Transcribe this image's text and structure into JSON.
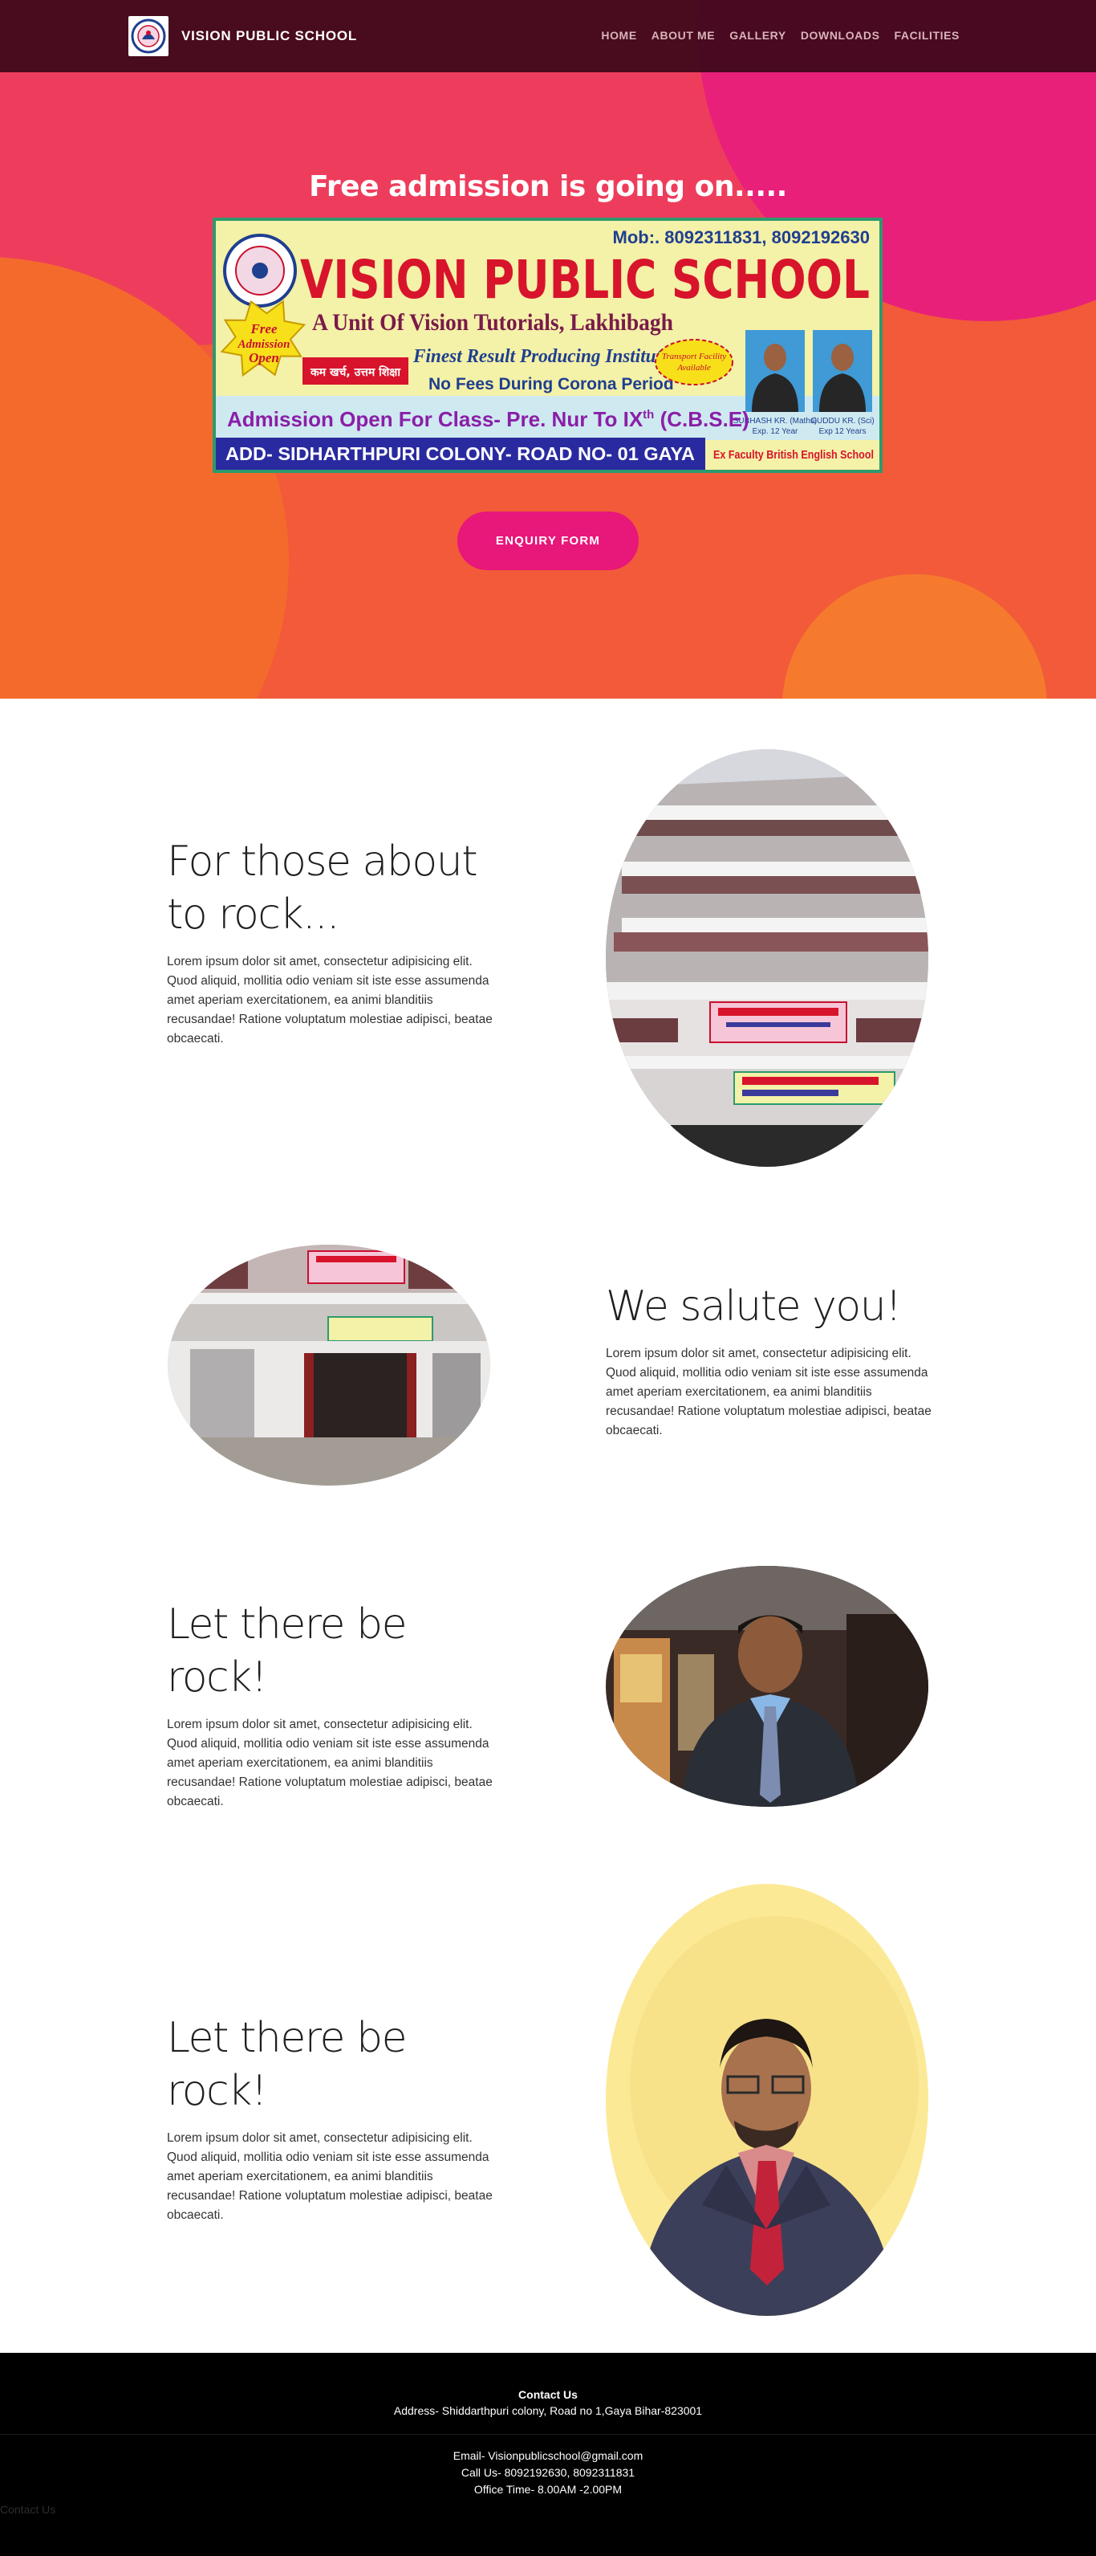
{
  "brand": {
    "name": "VISION PUBLIC SCHOOL",
    "logo_icon": "school-crest-icon"
  },
  "nav": {
    "items": [
      "HOME",
      "ABOUT ME",
      "GALLERY",
      "DOWNLOADS",
      "FACILITIES"
    ]
  },
  "hero": {
    "title": "Free admission is going on.....",
    "button_label": "ENQUIRY FORM",
    "banner": {
      "mob": "Mob:. 8092311831, 8092192630",
      "school_name": "VISION PUBLIC SCHOOL",
      "unit_line": "A Unit Of Vision Tutorials, Lakhibagh",
      "badge_free": "Free",
      "badge_admission": "Admission",
      "badge_open": "Open",
      "hindi_tag": "कम खर्च, उत्तम शिक्षा",
      "result_line": "Finest Result Producing Institution",
      "no_fees": "No Fees During Corona Period",
      "transport_1": "Transport Facility",
      "transport_2": "Available",
      "admission_line": "Admission Open For Class- Pre. Nur To IX",
      "admission_sup": "th",
      "admission_board": " (C.B.S.E)",
      "address_line": "ADD- SIDHARTHPURI COLONY- ROAD NO- 01 GAYA",
      "ex_faculty": "Ex Faculty British English School",
      "teacher1_name": "SUBHASH KR. (Maths)",
      "teacher1_exp": "Exp. 12 Year",
      "teacher2_name": "GUDDU KR. (Sci)",
      "teacher2_exp": "Exp 12 Years"
    }
  },
  "sections": [
    {
      "heading_line1": "For those about",
      "heading_line2": "to rock...",
      "body": "Lorem ipsum dolor sit amet, consectetur adipisicing elit. Quod aliquid, mollitia odio veniam sit iste esse assumenda amet aperiam exercitationem, ea animi blanditiis recusandae! Ratione voluptatum molestiae adipisci, beatae obcaecati.",
      "image": "school-building-photo"
    },
    {
      "heading": "We salute you!",
      "body": "Lorem ipsum dolor sit amet, consectetur adipisicing elit. Quod aliquid, mollitia odio veniam sit iste esse assumenda amet aperiam exercitationem, ea animi blanditiis recusandae! Ratione voluptatum molestiae adipisci, beatae obcaecati.",
      "image": "school-entrance-photo"
    },
    {
      "heading": "Let there be rock!",
      "body": "Lorem ipsum dolor sit amet, consectetur adipisicing elit. Quod aliquid, mollitia odio veniam sit iste esse assumenda amet aperiam exercitationem, ea animi blanditiis recusandae! Ratione voluptatum molestiae adipisci, beatae obcaecati.",
      "image": "teacher-portrait-photo"
    },
    {
      "heading": "Let there be rock!",
      "body": "Lorem ipsum dolor sit amet, consectetur adipisicing elit. Quod aliquid, mollitia odio veniam sit iste esse assumenda amet aperiam exercitationem, ea animi blanditiis recusandae! Ratione voluptatum molestiae adipisci, beatae obcaecati.",
      "image": "principal-portrait-photo"
    }
  ],
  "footer": {
    "title": "Contact Us",
    "address": "Address- Shiddarthpuri colony, Road no 1,Gaya Bihar-823001",
    "email": "Email- Visionpublicschool@gmail.com",
    "phone": "Call Us- 8092192630, 8092311831",
    "hours": "Office Time- 8.00AM -2.00PM",
    "link": "Contact Us"
  },
  "colors": {
    "nav_bg": "#3c081a",
    "hero_orange": "#f25a3a",
    "hero_pink": "#e8177a",
    "button": "#e8177a",
    "footer_bg": "#000000"
  }
}
